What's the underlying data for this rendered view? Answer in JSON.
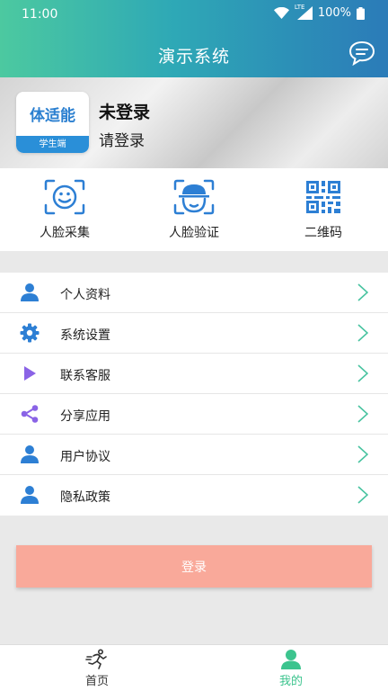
{
  "status": {
    "time": "11:00",
    "network": "LTE",
    "battery": "100%"
  },
  "header": {
    "title": "演示系统",
    "message_icon": "message-icon"
  },
  "profile": {
    "logo_title": "体适能",
    "logo_subtitle": "学生端",
    "status": "未登录",
    "hint": "请登录"
  },
  "quick_actions": [
    {
      "label": "人脸采集",
      "icon": "face-capture-icon"
    },
    {
      "label": "人脸验证",
      "icon": "face-verify-icon"
    },
    {
      "label": "二维码",
      "icon": "qrcode-icon"
    }
  ],
  "menu": [
    {
      "label": "个人资料",
      "icon": "person-icon"
    },
    {
      "label": "系统设置",
      "icon": "gear-icon"
    },
    {
      "label": "联系客服",
      "icon": "play-icon"
    },
    {
      "label": "分享应用",
      "icon": "share-icon"
    },
    {
      "label": "用户协议",
      "icon": "person-icon"
    },
    {
      "label": "隐私政策",
      "icon": "person-icon"
    }
  ],
  "login_button": "登录",
  "tabs": [
    {
      "label": "首页",
      "icon": "home-runner-icon",
      "active": false
    },
    {
      "label": "我的",
      "icon": "profile-icon",
      "active": true
    }
  ],
  "colors": {
    "header_start": "#4cc9a0",
    "header_end": "#2b7bb8",
    "icon_blue": "#2d7fd4",
    "icon_purple": "#8a63e6",
    "arrow_green": "#48c3a0",
    "login_button": "#f9a99a",
    "tab_active": "#3cc48e",
    "tab_inactive": "#333333"
  }
}
